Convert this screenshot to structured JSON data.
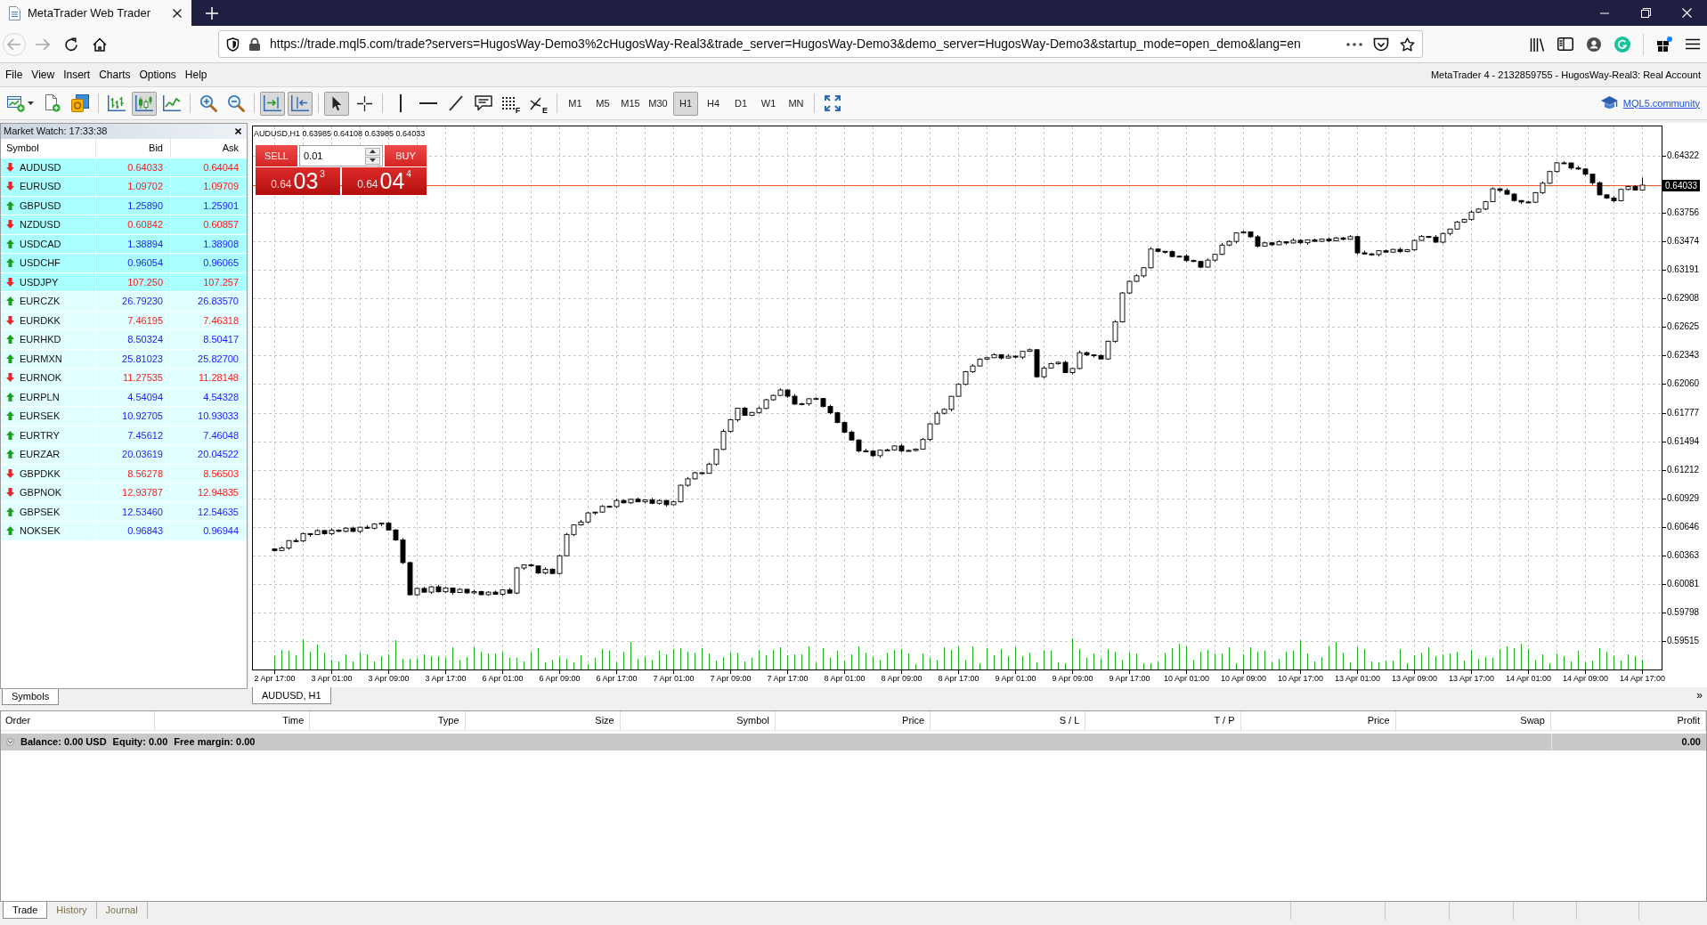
{
  "browser": {
    "tab_title": "MetaTrader Web Trader",
    "url": "https://trade.mql5.com/trade?servers=HugosWay-Demo3%2cHugosWay-Real3&trade_server=HugosWay-Demo3&demo_server=HugosWay-Demo3&startup_mode=open_demo&lang=en"
  },
  "menu": [
    "File",
    "View",
    "Insert",
    "Charts",
    "Options",
    "Help"
  ],
  "account_info": "MetaTrader 4 - 2132859755 - HugosWay-Real3: Real Account",
  "toolbar": {
    "chart_types": [
      {
        "selected": false
      },
      {
        "selected": true
      },
      {
        "selected": false
      }
    ],
    "auto_scroll": {
      "on": true
    },
    "chart_shift": {
      "on": true
    },
    "cursor_modes": [
      {
        "selected": true
      },
      {
        "selected": false
      }
    ],
    "fibonacci_marks": [
      "F",
      "E"
    ],
    "timeframes": [
      {
        "label": "M1",
        "selected": false
      },
      {
        "label": "M5",
        "selected": false
      },
      {
        "label": "M15",
        "selected": false
      },
      {
        "label": "M30",
        "selected": false
      },
      {
        "label": "H1",
        "selected": true
      },
      {
        "label": "H4",
        "selected": false
      },
      {
        "label": "D1",
        "selected": false
      },
      {
        "label": "W1",
        "selected": false
      },
      {
        "label": "MN",
        "selected": false
      }
    ],
    "community_link": "MQL5.community"
  },
  "market_watch": {
    "title": "Market Watch: 17:33:38",
    "columns": [
      "Symbol",
      "Bid",
      "Ask"
    ],
    "rows": [
      {
        "symbol": "AUDUSD",
        "bid": "0.64033",
        "ask": "0.64044",
        "rising": false,
        "highlighted": true
      },
      {
        "symbol": "EURUSD",
        "bid": "1.09702",
        "ask": "1.09709",
        "rising": false,
        "highlighted": true
      },
      {
        "symbol": "GBPUSD",
        "bid": "1.25890",
        "ask": "1.25901",
        "rising": true,
        "highlighted": true
      },
      {
        "symbol": "NZDUSD",
        "bid": "0.60842",
        "ask": "0.60857",
        "rising": false,
        "highlighted": true
      },
      {
        "symbol": "USDCAD",
        "bid": "1.38894",
        "ask": "1.38908",
        "rising": true,
        "highlighted": true
      },
      {
        "symbol": "USDCHF",
        "bid": "0.96054",
        "ask": "0.96065",
        "rising": true,
        "highlighted": true
      },
      {
        "symbol": "USDJPY",
        "bid": "107.250",
        "ask": "107.257",
        "rising": false,
        "highlighted": true
      },
      {
        "symbol": "EURCZK",
        "bid": "26.79230",
        "ask": "26.83570",
        "rising": true,
        "highlighted": false
      },
      {
        "symbol": "EURDKK",
        "bid": "7.46195",
        "ask": "7.46318",
        "rising": false,
        "highlighted": false
      },
      {
        "symbol": "EURHKD",
        "bid": "8.50324",
        "ask": "8.50417",
        "rising": true,
        "highlighted": false
      },
      {
        "symbol": "EURMXN",
        "bid": "25.81023",
        "ask": "25.82700",
        "rising": true,
        "highlighted": false
      },
      {
        "symbol": "EURNOK",
        "bid": "11.27535",
        "ask": "11.28148",
        "rising": false,
        "highlighted": false
      },
      {
        "symbol": "EURPLN",
        "bid": "4.54094",
        "ask": "4.54328",
        "rising": true,
        "highlighted": false
      },
      {
        "symbol": "EURSEK",
        "bid": "10.92705",
        "ask": "10.93033",
        "rising": true,
        "highlighted": false
      },
      {
        "symbol": "EURTRY",
        "bid": "7.45612",
        "ask": "7.46048",
        "rising": true,
        "highlighted": false
      },
      {
        "symbol": "EURZAR",
        "bid": "20.03619",
        "ask": "20.04522",
        "rising": true,
        "highlighted": false
      },
      {
        "symbol": "GBPDKK",
        "bid": "8.56278",
        "ask": "8.56503",
        "rising": false,
        "highlighted": false
      },
      {
        "symbol": "GBPNOK",
        "bid": "12.93787",
        "ask": "12.94835",
        "rising": false,
        "highlighted": false
      },
      {
        "symbol": "GBPSEK",
        "bid": "12.53460",
        "ask": "12.54635",
        "rising": true,
        "highlighted": false
      },
      {
        "symbol": "NOKSEK",
        "bid": "0.96843",
        "ask": "0.96944",
        "rising": true,
        "highlighted": false
      }
    ],
    "tab": "Symbols"
  },
  "chart": {
    "header": "AUDUSD,H1 0.63985 0.64108 0.63985 0.64033",
    "trade_panel": {
      "sell_label": "SELL",
      "lot": "0.01",
      "buy_label": "BUY",
      "sell_quote": {
        "prefix": "0.64",
        "pips": "03",
        "fraction": "3"
      },
      "buy_quote": {
        "prefix": "0.64",
        "pips": "04",
        "fraction": "4"
      }
    },
    "chart_data": {
      "type": "candlestick",
      "ylim": [
        0.5923,
        0.6462
      ],
      "grid": true,
      "categories": [
        "2 Apr 17:00",
        null,
        null,
        null,
        null,
        null,
        null,
        null,
        "3 Apr 01:00",
        null,
        null,
        null,
        null,
        null,
        null,
        null,
        "3 Apr 09:00",
        null,
        null,
        null,
        null,
        null,
        null,
        null,
        "3 Apr 17:00",
        null,
        null,
        null,
        null,
        null,
        null,
        null,
        "6 Apr 01:00",
        null,
        null,
        null,
        null,
        null,
        null,
        null,
        "6 Apr 09:00",
        null,
        null,
        null,
        null,
        null,
        null,
        null,
        "6 Apr 17:00",
        null,
        null,
        null,
        null,
        null,
        null,
        null,
        "7 Apr 01:00",
        null,
        null,
        null,
        null,
        null,
        null,
        null,
        "7 Apr 09:00",
        null,
        null,
        null,
        null,
        null,
        null,
        null,
        "7 Apr 17:00",
        null,
        null,
        null,
        null,
        null,
        null,
        null,
        "8 Apr 01:00",
        null,
        null,
        null,
        null,
        null,
        null,
        null,
        "8 Apr 09:00",
        null,
        null,
        null,
        null,
        null,
        null,
        null,
        "8 Apr 17:00",
        null,
        null,
        null,
        null,
        null,
        null,
        null,
        "9 Apr 01:00",
        null,
        null,
        null,
        null,
        null,
        null,
        null,
        "9 Apr 09:00",
        null,
        null,
        null,
        null,
        null,
        null,
        null,
        "9 Apr 17:00",
        null,
        null,
        null,
        null,
        null,
        null,
        null,
        "10 Apr 01:00",
        null,
        null,
        null,
        null,
        null,
        null,
        null,
        "10 Apr 09:00",
        null,
        null,
        null,
        null,
        null,
        null,
        null,
        "10 Apr 17:00",
        null,
        null,
        null,
        null,
        null,
        null,
        null,
        "13 Apr 01:00",
        null,
        null,
        null,
        null,
        null,
        null,
        null,
        "13 Apr 09:00",
        null,
        null,
        null,
        null,
        null,
        null,
        null,
        "13 Apr 17:00",
        null,
        null,
        null,
        null,
        null,
        null,
        null,
        "14 Apr 01:00",
        null,
        null,
        null,
        null,
        null,
        null,
        null,
        "14 Apr 09:00",
        null,
        null,
        null,
        null,
        null,
        null,
        null,
        "14 Apr 17:00"
      ],
      "ohlc": [
        [
          0.60425,
          0.60433,
          0.604,
          0.6041
        ],
        [
          0.6041,
          0.6045,
          0.60406,
          0.60435
        ],
        [
          0.60435,
          0.60513,
          0.60419,
          0.60508
        ],
        [
          0.60508,
          0.60528,
          0.60498,
          0.60505
        ],
        [
          0.60505,
          0.60588,
          0.60493,
          0.60578
        ],
        [
          0.60578,
          0.60581,
          0.60548,
          0.60568
        ],
        [
          0.60568,
          0.6062,
          0.60563,
          0.60608
        ],
        [
          0.60608,
          0.60614,
          0.60567,
          0.60576
        ],
        [
          0.60576,
          0.60629,
          0.60562,
          0.60611
        ],
        [
          0.60611,
          0.6062,
          0.60594,
          0.606
        ],
        [
          0.606,
          0.6064,
          0.6059,
          0.60632
        ],
        [
          0.60632,
          0.60647,
          0.60595,
          0.60599
        ],
        [
          0.60599,
          0.60646,
          0.60583,
          0.60641
        ],
        [
          0.60641,
          0.60661,
          0.60624,
          0.60631
        ],
        [
          0.60631,
          0.60682,
          0.60619,
          0.60672
        ],
        [
          0.60672,
          0.60684,
          0.60652,
          0.60681
        ],
        [
          0.60681,
          0.60693,
          0.60609,
          0.60614
        ],
        [
          0.60614,
          0.6062,
          0.60506,
          0.60515
        ],
        [
          0.60515,
          0.60533,
          0.60276,
          0.6029
        ],
        [
          0.6029,
          0.60299,
          0.59965,
          0.59971
        ],
        [
          0.59971,
          0.60042,
          0.59961,
          0.60034
        ],
        [
          0.60034,
          0.60049,
          0.59993,
          0.59997
        ],
        [
          0.59997,
          0.60055,
          0.59981,
          0.6005
        ],
        [
          0.6005,
          0.6007,
          0.59994,
          0.60001
        ],
        [
          0.60001,
          0.60048,
          0.59989,
          0.60038
        ],
        [
          0.60038,
          0.60041,
          0.59974,
          0.59994
        ],
        [
          0.59994,
          0.60037,
          0.59989,
          0.60025
        ],
        [
          0.60025,
          0.60031,
          0.59981,
          0.5999
        ],
        [
          0.5999,
          0.6002,
          0.59976,
          0.60002
        ],
        [
          0.60002,
          0.60011,
          0.59966,
          0.59972
        ],
        [
          0.59972,
          0.60005,
          0.59962,
          0.59997
        ],
        [
          0.59997,
          0.60012,
          0.59972,
          0.59976
        ],
        [
          0.59976,
          0.60024,
          0.5996,
          0.60019
        ],
        [
          0.60019,
          0.60039,
          0.59981,
          0.59988
        ],
        [
          0.59988,
          0.60247,
          0.59976,
          0.60237
        ],
        [
          0.60237,
          0.6027,
          0.60217,
          0.60267
        ],
        [
          0.60267,
          0.60279,
          0.60252,
          0.60257
        ],
        [
          0.60257,
          0.60263,
          0.60178,
          0.60187
        ],
        [
          0.60187,
          0.60242,
          0.60173,
          0.60224
        ],
        [
          0.60224,
          0.60233,
          0.60176,
          0.60182
        ],
        [
          0.60182,
          0.60366,
          0.60172,
          0.60358
        ],
        [
          0.60358,
          0.60584,
          0.60354,
          0.60569
        ],
        [
          0.60569,
          0.60669,
          0.60553,
          0.60664
        ],
        [
          0.60664,
          0.60713,
          0.60657,
          0.60693
        ],
        [
          0.60693,
          0.60793,
          0.60681,
          0.60783
        ],
        [
          0.60783,
          0.60794,
          0.60763,
          0.60791
        ],
        [
          0.60791,
          0.6086,
          0.60786,
          0.60848
        ],
        [
          0.60848,
          0.60854,
          0.60837,
          0.60846
        ],
        [
          0.60846,
          0.60924,
          0.60832,
          0.60906
        ],
        [
          0.60906,
          0.60915,
          0.60877,
          0.60883
        ],
        [
          0.60883,
          0.60926,
          0.60873,
          0.60918
        ],
        [
          0.60918,
          0.60933,
          0.60889,
          0.60893
        ],
        [
          0.60893,
          0.60916,
          0.60877,
          0.60911
        ],
        [
          0.60911,
          0.60931,
          0.60871,
          0.60878
        ],
        [
          0.60878,
          0.60916,
          0.60866,
          0.60906
        ],
        [
          0.60906,
          0.60909,
          0.60844,
          0.60864
        ],
        [
          0.60864,
          0.60905,
          0.60859,
          0.60893
        ],
        [
          0.60893,
          0.61063,
          0.60884,
          0.61057
        ],
        [
          0.61057,
          0.61139,
          0.61043,
          0.61121
        ],
        [
          0.61121,
          0.6119,
          0.61115,
          0.61181
        ],
        [
          0.61181,
          0.61189,
          0.61165,
          0.61175
        ],
        [
          0.61175,
          0.61282,
          0.61171,
          0.61267
        ],
        [
          0.61267,
          0.61418,
          0.61251,
          0.61413
        ],
        [
          0.61413,
          0.61611,
          0.61406,
          0.61591
        ],
        [
          0.61591,
          0.61717,
          0.61579,
          0.61707
        ],
        [
          0.61707,
          0.61824,
          0.61687,
          0.61821
        ],
        [
          0.61821,
          0.61833,
          0.61746,
          0.61751
        ],
        [
          0.61751,
          0.61785,
          0.61742,
          0.61779
        ],
        [
          0.61779,
          0.61837,
          0.61765,
          0.61819
        ],
        [
          0.61819,
          0.61914,
          0.61813,
          0.61905
        ],
        [
          0.61905,
          0.61956,
          0.61895,
          0.61948
        ],
        [
          0.61948,
          0.62017,
          0.61944,
          0.62002
        ],
        [
          0.62002,
          0.62007,
          0.61924,
          0.6194
        ],
        [
          0.6194,
          0.6196,
          0.61855,
          0.61862
        ],
        [
          0.61862,
          0.61876,
          0.6185,
          0.61866
        ],
        [
          0.61866,
          0.61918,
          0.61846,
          0.61915
        ],
        [
          0.61915,
          0.61929,
          0.6191,
          0.61917
        ],
        [
          0.61917,
          0.61923,
          0.61829,
          0.61838
        ],
        [
          0.61838,
          0.61856,
          0.61762,
          0.61776
        ],
        [
          0.61776,
          0.61785,
          0.61673,
          0.61679
        ],
        [
          0.61679,
          0.61687,
          0.61574,
          0.61584
        ],
        [
          0.61584,
          0.61599,
          0.61502,
          0.61506
        ],
        [
          0.61506,
          0.61511,
          0.61382,
          0.61398
        ],
        [
          0.61398,
          0.61418,
          0.61389,
          0.61396
        ],
        [
          0.61396,
          0.61406,
          0.61338,
          0.6135
        ],
        [
          0.6135,
          0.61408,
          0.6133,
          0.61405
        ],
        [
          0.61405,
          0.6142,
          0.614,
          0.61408
        ],
        [
          0.61408,
          0.61453,
          0.61399,
          0.61447
        ],
        [
          0.61447,
          0.61465,
          0.61384,
          0.61398
        ],
        [
          0.61398,
          0.61411,
          0.61392,
          0.61402
        ],
        [
          0.61402,
          0.61423,
          0.61392,
          0.61415
        ],
        [
          0.61415,
          0.61526,
          0.61411,
          0.61511
        ],
        [
          0.61511,
          0.61671,
          0.61495,
          0.61666
        ],
        [
          0.61666,
          0.61791,
          0.61659,
          0.61771
        ],
        [
          0.61771,
          0.6182,
          0.61759,
          0.6181
        ],
        [
          0.6181,
          0.61942,
          0.6179,
          0.61939
        ],
        [
          0.61939,
          0.6207,
          0.61934,
          0.62058
        ],
        [
          0.62058,
          0.6219,
          0.62049,
          0.62184
        ],
        [
          0.62184,
          0.62258,
          0.6217,
          0.6224
        ],
        [
          0.6224,
          0.62317,
          0.62234,
          0.62308
        ],
        [
          0.62308,
          0.6233,
          0.62298,
          0.62322
        ],
        [
          0.62322,
          0.62367,
          0.62318,
          0.62352
        ],
        [
          0.62352,
          0.62357,
          0.62303,
          0.62319
        ],
        [
          0.62319,
          0.62357,
          0.62312,
          0.62337
        ],
        [
          0.62337,
          0.62347,
          0.62316,
          0.62328
        ],
        [
          0.62328,
          0.62388,
          0.62308,
          0.62385
        ],
        [
          0.62385,
          0.62413,
          0.6238,
          0.62401
        ],
        [
          0.62401,
          0.62407,
          0.62124,
          0.62133
        ],
        [
          0.62133,
          0.62238,
          0.62119,
          0.6222
        ],
        [
          0.6222,
          0.62272,
          0.62214,
          0.62263
        ],
        [
          0.62263,
          0.62284,
          0.62253,
          0.62276
        ],
        [
          0.62276,
          0.62291,
          0.6217,
          0.62174
        ],
        [
          0.62174,
          0.6222,
          0.62158,
          0.62215
        ],
        [
          0.62215,
          0.62392,
          0.62208,
          0.62372
        ],
        [
          0.62372,
          0.62382,
          0.62338,
          0.6235
        ],
        [
          0.6235,
          0.62353,
          0.62324,
          0.62344
        ],
        [
          0.62344,
          0.62356,
          0.62305,
          0.6231
        ],
        [
          0.6231,
          0.62491,
          0.62301,
          0.62485
        ],
        [
          0.62485,
          0.62695,
          0.62471,
          0.62677
        ],
        [
          0.62677,
          0.62973,
          0.62671,
          0.62964
        ],
        [
          0.62964,
          0.63087,
          0.62954,
          0.63079
        ],
        [
          0.63079,
          0.63149,
          0.63075,
          0.63134
        ],
        [
          0.63134,
          0.63219,
          0.63118,
          0.63214
        ],
        [
          0.63214,
          0.63419,
          0.63207,
          0.63399
        ],
        [
          0.63399,
          0.63409,
          0.63365,
          0.63377
        ],
        [
          0.63377,
          0.6338,
          0.63354,
          0.63374
        ],
        [
          0.63374,
          0.63386,
          0.6332,
          0.63325
        ],
        [
          0.63325,
          0.63335,
          0.63316,
          0.63329
        ],
        [
          0.63329,
          0.63347,
          0.63271,
          0.63285
        ],
        [
          0.63285,
          0.63294,
          0.6327,
          0.63276
        ],
        [
          0.63276,
          0.63284,
          0.6321,
          0.6322
        ],
        [
          0.6322,
          0.63305,
          0.63216,
          0.6329
        ],
        [
          0.6329,
          0.63352,
          0.63274,
          0.63347
        ],
        [
          0.63347,
          0.63459,
          0.6334,
          0.63439
        ],
        [
          0.63439,
          0.63485,
          0.63427,
          0.63475
        ],
        [
          0.63475,
          0.63562,
          0.63455,
          0.63559
        ],
        [
          0.63559,
          0.63581,
          0.63554,
          0.63569
        ],
        [
          0.63569,
          0.63575,
          0.63512,
          0.63521
        ],
        [
          0.63521,
          0.63539,
          0.63414,
          0.63428
        ],
        [
          0.63428,
          0.6347,
          0.63422,
          0.63461
        ],
        [
          0.63461,
          0.63469,
          0.63432,
          0.63442
        ],
        [
          0.63442,
          0.63487,
          0.63438,
          0.63472
        ],
        [
          0.63472,
          0.63477,
          0.63444,
          0.6346
        ],
        [
          0.6346,
          0.63506,
          0.63453,
          0.63486
        ],
        [
          0.63486,
          0.63496,
          0.6345,
          0.63462
        ],
        [
          0.63462,
          0.63494,
          0.63442,
          0.63491
        ],
        [
          0.63491,
          0.63503,
          0.63471,
          0.63476
        ],
        [
          0.63476,
          0.63504,
          0.63467,
          0.63498
        ],
        [
          0.63498,
          0.63516,
          0.63467,
          0.63481
        ],
        [
          0.63481,
          0.63519,
          0.63475,
          0.6351
        ],
        [
          0.6351,
          0.63518,
          0.63486,
          0.63496
        ],
        [
          0.63496,
          0.63538,
          0.63492,
          0.63523
        ],
        [
          0.63523,
          0.63528,
          0.63346,
          0.63362
        ],
        [
          0.63362,
          0.63382,
          0.63344,
          0.63351
        ],
        [
          0.63351,
          0.63361,
          0.63333,
          0.63345
        ],
        [
          0.63345,
          0.63386,
          0.63325,
          0.63383
        ],
        [
          0.63383,
          0.63395,
          0.63364,
          0.63369
        ],
        [
          0.63369,
          0.63402,
          0.6336,
          0.63396
        ],
        [
          0.63396,
          0.63414,
          0.6336,
          0.63374
        ],
        [
          0.63374,
          0.63401,
          0.63368,
          0.63392
        ],
        [
          0.63392,
          0.63493,
          0.63382,
          0.63485
        ],
        [
          0.63485,
          0.63539,
          0.63481,
          0.63524
        ],
        [
          0.63524,
          0.63529,
          0.63508,
          0.63518
        ],
        [
          0.63518,
          0.63538,
          0.63461,
          0.63468
        ],
        [
          0.63468,
          0.63564,
          0.63456,
          0.63554
        ],
        [
          0.63554,
          0.63601,
          0.63534,
          0.63598
        ],
        [
          0.63598,
          0.63679,
          0.63593,
          0.63667
        ],
        [
          0.63667,
          0.637,
          0.63658,
          0.63694
        ],
        [
          0.63694,
          0.63784,
          0.6368,
          0.63766
        ],
        [
          0.63766,
          0.63805,
          0.6376,
          0.63796
        ],
        [
          0.63796,
          0.63877,
          0.63786,
          0.63869
        ],
        [
          0.63869,
          0.64012,
          0.63865,
          0.63997
        ],
        [
          0.63997,
          0.64002,
          0.63965,
          0.63981
        ],
        [
          0.63981,
          0.64001,
          0.63937,
          0.63944
        ],
        [
          0.63944,
          0.63954,
          0.63869,
          0.63881
        ],
        [
          0.63881,
          0.63884,
          0.63846,
          0.63866
        ],
        [
          0.63866,
          0.63878,
          0.63859,
          0.63864
        ],
        [
          0.63864,
          0.63965,
          0.63855,
          0.63959
        ],
        [
          0.63959,
          0.6407,
          0.63945,
          0.64052
        ],
        [
          0.64052,
          0.64177,
          0.64046,
          0.64168
        ],
        [
          0.64168,
          0.64262,
          0.64158,
          0.64254
        ],
        [
          0.64254,
          0.64269,
          0.64249,
          0.64253
        ],
        [
          0.64253,
          0.64258,
          0.64187,
          0.64203
        ],
        [
          0.64203,
          0.64223,
          0.64186,
          0.64193
        ],
        [
          0.64193,
          0.64203,
          0.6413,
          0.64142
        ],
        [
          0.64142,
          0.64145,
          0.64037,
          0.64057
        ],
        [
          0.64057,
          0.64069,
          0.63932,
          0.63937
        ],
        [
          0.63937,
          0.63943,
          0.63897,
          0.63906
        ],
        [
          0.63906,
          0.63924,
          0.63864,
          0.63878
        ],
        [
          0.63878,
          0.64,
          0.63872,
          0.63991
        ],
        [
          0.63991,
          0.64027,
          0.63981,
          0.64019
        ],
        [
          0.64019,
          0.64034,
          0.63981,
          0.63985
        ],
        [
          0.63985,
          0.64108,
          0.63985,
          0.64033
        ]
      ],
      "yticks": [
        {
          "value": 0.64322,
          "label": "0.64322"
        },
        {
          "value": 0.63756,
          "label": "0.63756"
        },
        {
          "value": 0.63474,
          "label": "0.63474"
        },
        {
          "value": 0.63191,
          "label": "0.63191"
        },
        {
          "value": 0.62908,
          "label": "0.62908"
        },
        {
          "value": 0.62625,
          "label": "0.62625"
        },
        {
          "value": 0.62343,
          "label": "0.62343"
        },
        {
          "value": 0.6206,
          "label": "0.62060"
        },
        {
          "value": 0.61777,
          "label": "0.61777"
        },
        {
          "value": 0.61494,
          "label": "0.61494"
        },
        {
          "value": 0.61212,
          "label": "0.61212"
        },
        {
          "value": 0.60929,
          "label": "0.60929"
        },
        {
          "value": 0.60646,
          "label": "0.60646"
        },
        {
          "value": 0.60363,
          "label": "0.60363"
        },
        {
          "value": 0.60081,
          "label": "0.60081"
        },
        {
          "value": 0.59798,
          "label": "0.59798"
        },
        {
          "value": 0.59515,
          "label": "0.59515"
        }
      ],
      "ref_lines": [
        {
          "axis": "y",
          "value": 0.64033,
          "label": "0.64033",
          "color": "#ee5a24"
        }
      ]
    },
    "tab": "AUDUSD, H1",
    "scroll_mark": "»"
  },
  "terminal": {
    "columns": [
      "Order",
      "Time",
      "Type",
      "Size",
      "Symbol",
      "Price",
      "S / L",
      "T / P",
      "Price",
      "Swap",
      "Profit"
    ],
    "balance": [
      "Balance: 0.00 USD",
      "Equity: 0.00",
      "Free margin: 0.00"
    ],
    "profit": "0.00",
    "tabs": [
      {
        "label": "Trade",
        "selected": true
      },
      {
        "label": "History",
        "selected": false
      },
      {
        "label": "Journal",
        "selected": false
      }
    ]
  }
}
